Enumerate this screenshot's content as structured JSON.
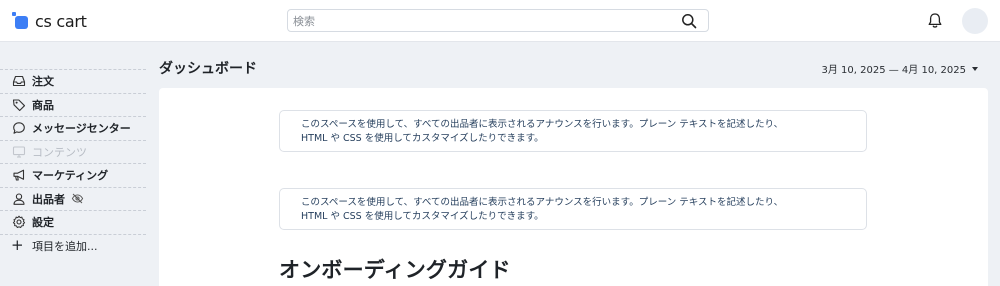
{
  "app": {
    "logo_text": "cs cart",
    "brand_color": "#3d7ef5"
  },
  "search": {
    "placeholder": "検索",
    "value": ""
  },
  "sidebar": {
    "items": [
      {
        "label": "注文",
        "icon": "inbox-icon",
        "enabled": true
      },
      {
        "label": "商品",
        "icon": "tag-icon",
        "enabled": true
      },
      {
        "label": "メッセージセンター",
        "icon": "chat-bubble-icon",
        "enabled": true
      },
      {
        "label": "コンテンツ",
        "icon": "monitor-icon",
        "enabled": false
      },
      {
        "label": "マーケティング",
        "icon": "megaphone-icon",
        "enabled": true
      },
      {
        "label": "出品者",
        "icon": "user-icon",
        "enabled": true,
        "badge_icon": "eye-off-icon"
      },
      {
        "label": "設定",
        "icon": "gear-icon",
        "enabled": true
      }
    ],
    "add_item": {
      "label": "項目を追加...",
      "icon": "plus-icon"
    }
  },
  "main": {
    "title": "ダッシュボード",
    "date_range": "3月 10, 2025 — 4月 10, 2025",
    "announcements": [
      {
        "line1": "このスペースを使用して、すべての出品者に表示されるアナウンスを行います。プレーン テキストを記述したり、",
        "line2": "HTML や CSS を使用してカスタマイズしたりできます。"
      },
      {
        "line1": "このスペースを使用して、すべての出品者に表示されるアナウンスを行います。プレーン テキストを記述したり、",
        "line2": "HTML や CSS を使用してカスタマイズしたりできます。"
      }
    ],
    "onboarding_title": "オンボーディングガイド"
  }
}
